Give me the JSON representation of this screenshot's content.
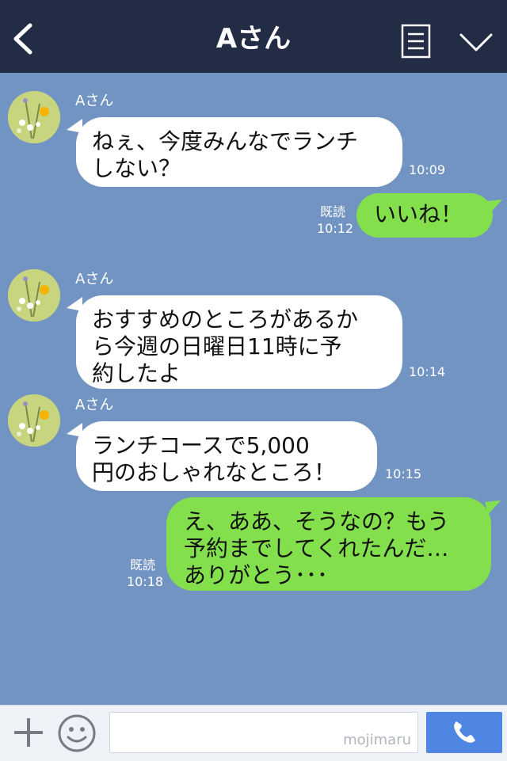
{
  "header": {
    "title": "Aさん",
    "back_icon": "chevron-left-icon",
    "menu_icon": "menu-icon",
    "collapse_icon": "chevron-down-icon"
  },
  "messages": [
    {
      "sender": "Aさん",
      "text": "ねぇ、今度みんなでランチ\nしない？",
      "time": "10:09"
    },
    {
      "read": "既読",
      "time": "10:12",
      "text": "いいね！"
    },
    {
      "sender": "Aさん",
      "text": "おすすめのところがあるか\nら今週の日曜日11時に予\n約したよ",
      "time": "10:14"
    },
    {
      "sender": "Aさん",
      "text": "ランチコースで5,000\n円のおしゃれなところ！",
      "time": "10:15"
    },
    {
      "read": "既読",
      "time": "10:18",
      "text": "え、ああ、そうなの？もう\n予約までしてくれたんだ…\nありがとう･･･"
    }
  ],
  "footer": {
    "input_value": "",
    "watermark": "mojimaru",
    "plus_icon": "plus-icon",
    "emoji_icon": "emoji-icon",
    "call_icon": "phone-icon"
  },
  "colors": {
    "header_bg": "#232c45",
    "chat_bg": "#7294c2",
    "incoming_bubble": "#ffffff",
    "outgoing_bubble": "#83e04c",
    "call_button": "#4f86e4"
  }
}
